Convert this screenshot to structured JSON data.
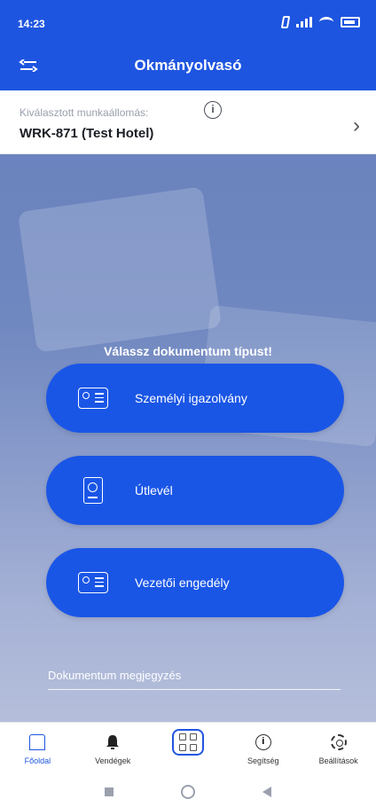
{
  "status_bar": {
    "time": "14:23",
    "icons": [
      "bluetooth-icon",
      "signal-icon",
      "wifi-icon",
      "battery-icon"
    ]
  },
  "app_bar": {
    "title": "Okmányolvasó",
    "back_icon": "swap-back-icon"
  },
  "station": {
    "label": "Kiválasztott munkaállomás:",
    "info_glyph": "i",
    "value": "WRK-871 (Test Hotel)",
    "chevron": "›"
  },
  "hero": {
    "title": "Válassz dokumentum típust!",
    "documents": [
      {
        "label": "Személyi igazolvány",
        "icon": "id-card-icon"
      },
      {
        "label": "Útlevél",
        "icon": "passport-icon"
      },
      {
        "label": "Vezetői engedély",
        "icon": "driver-license-icon"
      }
    ],
    "note_placeholder": "Dokumentum megjegyzés"
  },
  "bottom_nav": {
    "items": [
      {
        "label": "Főoldal",
        "icon": "home-icon",
        "active": true
      },
      {
        "label": "Vendégek",
        "icon": "bell-icon",
        "active": false
      },
      {
        "label": "",
        "icon": "qr-scan-icon",
        "active": false
      },
      {
        "label": "Segítség",
        "icon": "info-icon",
        "active": false
      },
      {
        "label": "Beállítások",
        "icon": "gear-icon",
        "active": false
      }
    ]
  },
  "colors": {
    "primary": "#1e55e0",
    "button": "#1a56e6",
    "hero_top": "#6b83be",
    "hero_bottom": "#b5bfdb"
  }
}
